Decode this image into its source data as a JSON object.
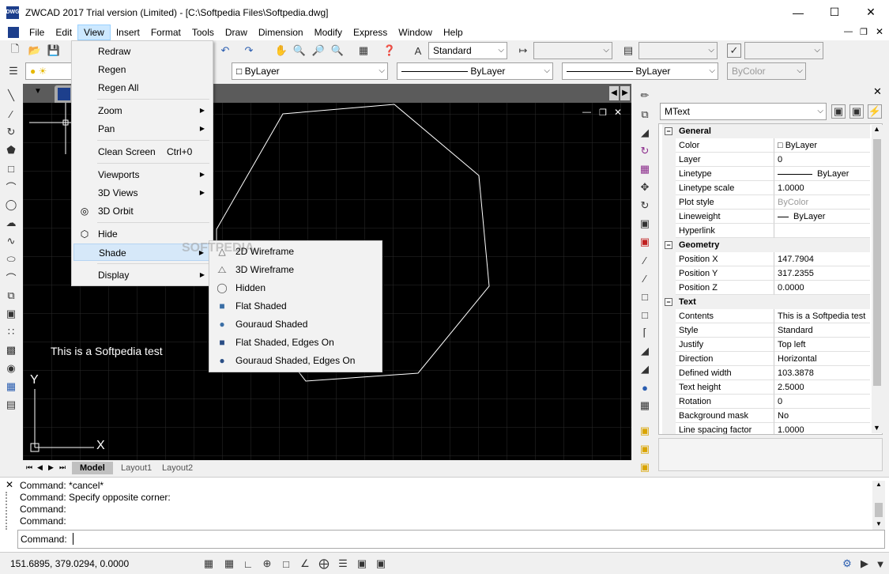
{
  "window": {
    "title": "ZWCAD 2017 Trial version (Limited) - [C:\\Softpedia Files\\Softpedia.dwg]",
    "app_icon_text": "DWG"
  },
  "menubar": {
    "items": [
      "File",
      "Edit",
      "View",
      "Insert",
      "Format",
      "Tools",
      "Draw",
      "Dimension",
      "Modify",
      "Express",
      "Window",
      "Help"
    ],
    "active": "View"
  },
  "toolbar": {
    "text_style": "Standard",
    "layer": "ByLayer",
    "linetype": "ByLayer",
    "lineweight": "ByLayer",
    "plot_style": "ByColor"
  },
  "view_menu": {
    "items": [
      {
        "label": "Redraw",
        "shortcut": "",
        "submenu": false
      },
      {
        "label": "Regen",
        "shortcut": "",
        "submenu": false
      },
      {
        "label": "Regen All",
        "shortcut": "",
        "submenu": false
      },
      {
        "label": "Zoom",
        "shortcut": "",
        "submenu": true
      },
      {
        "label": "Pan",
        "shortcut": "",
        "submenu": true
      },
      {
        "label": "Clean Screen",
        "shortcut": "Ctrl+0",
        "submenu": false
      },
      {
        "label": "Viewports",
        "shortcut": "",
        "submenu": true
      },
      {
        "label": "3D Views",
        "shortcut": "",
        "submenu": true
      },
      {
        "label": "3D Orbit",
        "shortcut": "",
        "submenu": false
      },
      {
        "label": "Hide",
        "shortcut": "",
        "submenu": false
      },
      {
        "label": "Shade",
        "shortcut": "",
        "submenu": true
      },
      {
        "label": "Display",
        "shortcut": "",
        "submenu": true
      }
    ]
  },
  "shade_menu": {
    "items": [
      "2D Wireframe",
      "3D Wireframe",
      "Hidden",
      "Flat Shaded",
      "Gouraud Shaded",
      "Flat Shaded, Edges On",
      "Gouraud Shaded, Edges On"
    ]
  },
  "drawing": {
    "text": "This is a Softpedia test",
    "axis_y": "Y",
    "axis_x": "X",
    "watermark": "SOFTPEDIA"
  },
  "layout_tabs": [
    "Model",
    "Layout1",
    "Layout2"
  ],
  "properties": {
    "object_type": "MText",
    "rows": [
      {
        "cat": true,
        "name": "General"
      },
      {
        "name": "Color",
        "value": "ByLayer"
      },
      {
        "name": "Layer",
        "value": "0"
      },
      {
        "name": "Linetype",
        "value": "ByLayer"
      },
      {
        "name": "Linetype scale",
        "value": "1.0000"
      },
      {
        "name": "Plot style",
        "value": "ByColor"
      },
      {
        "name": "Lineweight",
        "value": "ByLayer"
      },
      {
        "name": "Hyperlink",
        "value": ""
      },
      {
        "cat": true,
        "name": "Geometry"
      },
      {
        "name": "Position X",
        "value": "147.7904"
      },
      {
        "name": "Position Y",
        "value": "317.2355"
      },
      {
        "name": "Position Z",
        "value": "0.0000"
      },
      {
        "cat": true,
        "name": "Text"
      },
      {
        "name": "Contents",
        "value": "This is a Softpedia test"
      },
      {
        "name": "Style",
        "value": "Standard"
      },
      {
        "name": "Justify",
        "value": "Top left"
      },
      {
        "name": "Direction",
        "value": "Horizontal"
      },
      {
        "name": "Defined width",
        "value": "103.3878"
      },
      {
        "name": "Text height",
        "value": "2.5000"
      },
      {
        "name": "Rotation",
        "value": "0"
      },
      {
        "name": "Background mask",
        "value": "No"
      },
      {
        "name": "Line spacing factor",
        "value": "1.0000"
      }
    ]
  },
  "command": {
    "history": [
      "Command: *cancel*",
      "Command: Specify opposite corner:",
      "Command:",
      "Command:"
    ],
    "prompt": "Command:"
  },
  "status": {
    "coordinates": "151.6895, 379.0294, 0.0000"
  }
}
